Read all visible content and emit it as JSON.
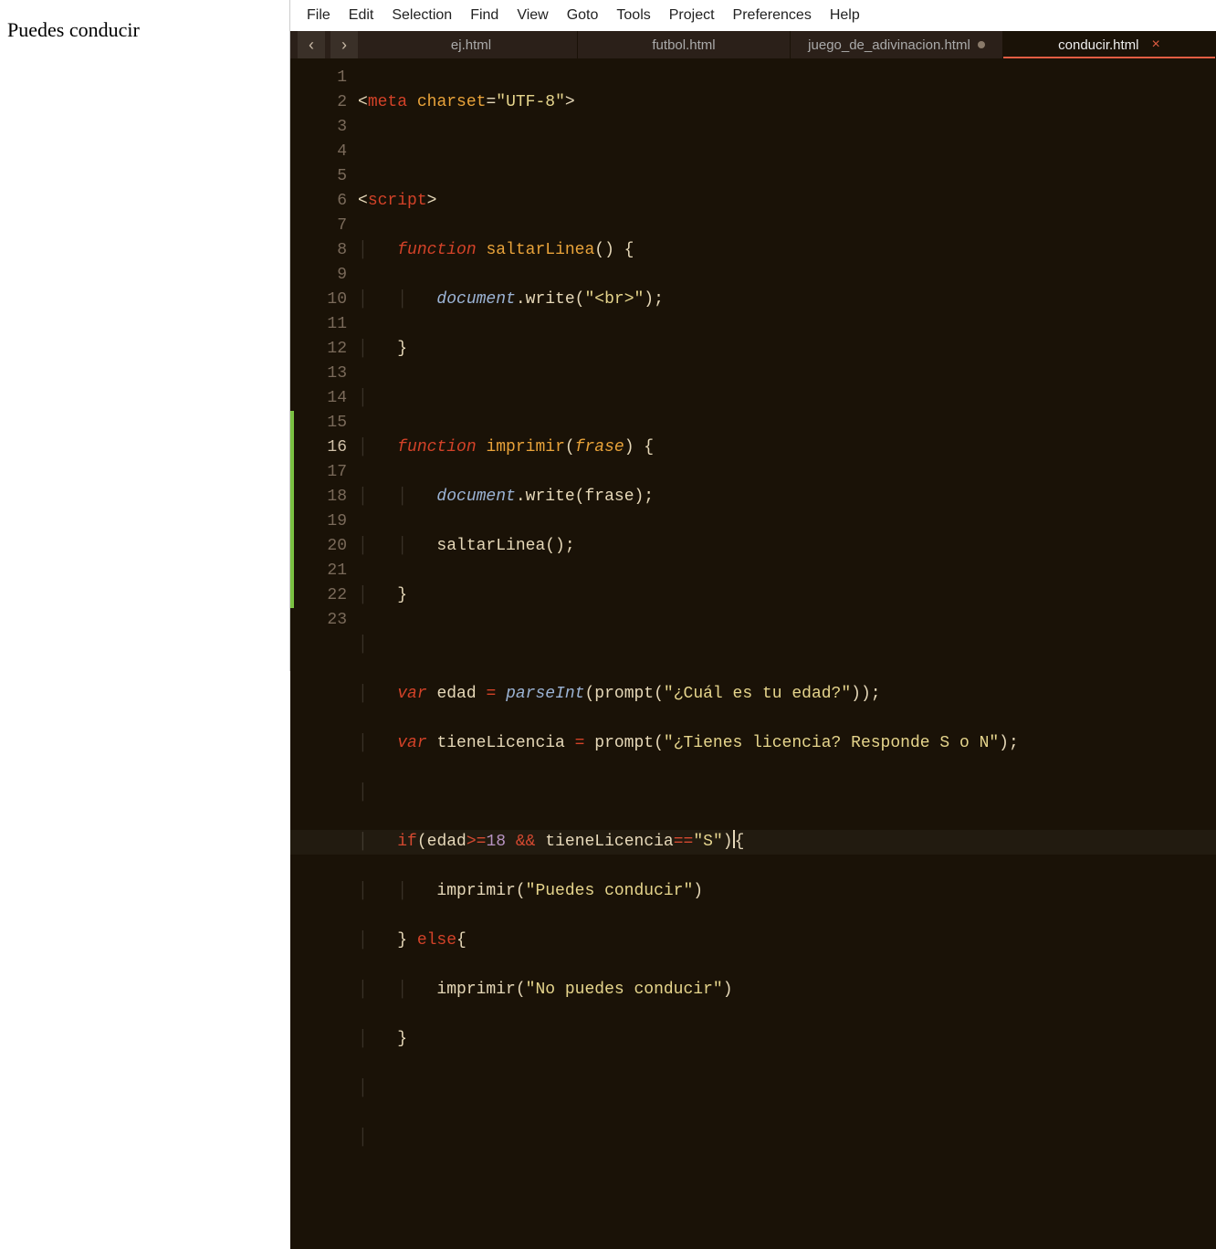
{
  "leftPane": {
    "output": "Puedes conducir"
  },
  "menubar": [
    "File",
    "Edit",
    "Selection",
    "Find",
    "View",
    "Goto",
    "Tools",
    "Project",
    "Preferences",
    "Help"
  ],
  "nav": {
    "back": "‹",
    "forward": "›"
  },
  "tabs": [
    {
      "label": "ej.html",
      "dirty": false,
      "active": false
    },
    {
      "label": "futbol.html",
      "dirty": false,
      "active": false
    },
    {
      "label": "juego_de_adivinacion.html",
      "dirty": true,
      "active": false
    },
    {
      "label": "conducir.html",
      "dirty": false,
      "active": true,
      "closeVisible": true
    }
  ],
  "editor": {
    "currentLine": 16,
    "lineCount": 23,
    "tokens": {
      "l1": {
        "open": "<",
        "tag": "meta",
        "attr": "charset",
        "eq": "=",
        "str": "\"UTF-8\"",
        "close": ">"
      },
      "l3": {
        "open": "<",
        "tag": "script",
        "close": ">"
      },
      "l4": {
        "kw": "function",
        "name": "saltarLinea",
        "paren": "() {"
      },
      "l5": {
        "obj": "document",
        "dot": ".",
        "call": "write",
        "open": "(",
        "str": "\"<br>\"",
        "close": ");"
      },
      "l6": {
        "brace": "}"
      },
      "l8": {
        "kw": "function",
        "name": "imprimir",
        "open": "(",
        "param": "frase",
        "close": ") {"
      },
      "l9": {
        "obj": "document",
        "dot": ".",
        "call": "write",
        "open": "(",
        "arg": "frase",
        "close": ");"
      },
      "l10": {
        "call": "saltarLinea",
        "rest": "();"
      },
      "l11": {
        "brace": "}"
      },
      "l13": {
        "kw": "var",
        "name": "edad",
        "eq": " = ",
        "fn": "parseInt",
        "open": "(",
        "call": "prompt",
        "open2": "(",
        "str": "\"¿Cuál es tu edad?\"",
        "close": "));"
      },
      "l14": {
        "kw": "var",
        "name": "tieneLicencia",
        "eq": " = ",
        "call": "prompt",
        "open": "(",
        "str": "\"¿Tienes licencia? Responde S o N\"",
        "close": ");"
      },
      "l16": {
        "kw": "if",
        "open": "(",
        "v1": "edad",
        "op1": ">=",
        "n": "18",
        "and": " && ",
        "v2": "tieneLicencia",
        "op2": "==",
        "str": "\"S\"",
        "close": ")",
        "brace": "{"
      },
      "l17": {
        "call": "imprimir",
        "open": "(",
        "str": "\"Puedes conducir\"",
        "close": ")"
      },
      "l18": {
        "brace": "} ",
        "kw": "else",
        "brace2": "{"
      },
      "l19": {
        "call": "imprimir",
        "open": "(",
        "str": "\"No puedes conducir\"",
        "close": ")"
      },
      "l20": {
        "brace": "}"
      }
    }
  }
}
